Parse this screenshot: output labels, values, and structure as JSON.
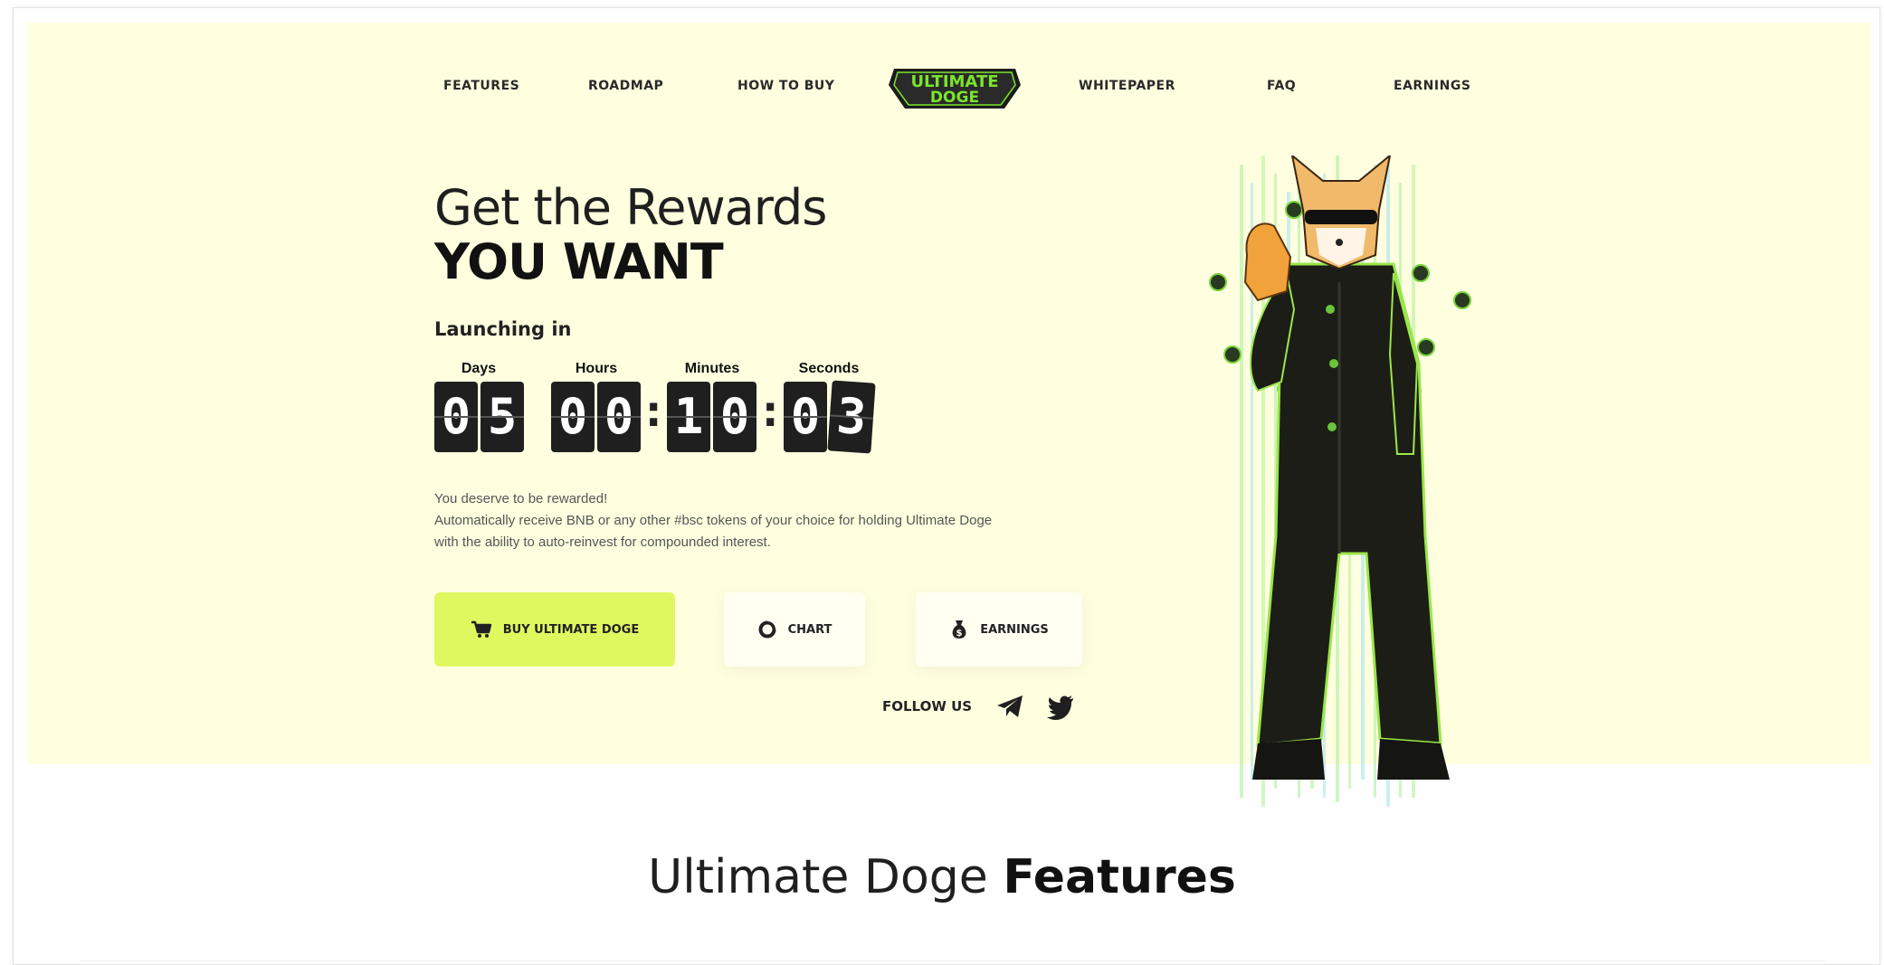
{
  "nav": {
    "items": [
      "FEATURES",
      "ROADMAP",
      "HOW TO BUY",
      "WHITEPAPER",
      "FAQ",
      "EARNINGS"
    ],
    "logo_line1": "ULTIMATE",
    "logo_line2": "DOGE"
  },
  "hero": {
    "title_line1": "Get the Rewards",
    "title_line2": "YOU WANT",
    "launching_label": "Launching in",
    "countdown": {
      "labels": [
        "Days",
        "Hours",
        "Minutes",
        "Seconds"
      ],
      "days": [
        "0",
        "5"
      ],
      "hours": [
        "0",
        "0"
      ],
      "minutes": [
        "1",
        "0"
      ],
      "seconds": [
        "0",
        "3"
      ]
    },
    "description": [
      "You deserve to be rewarded!",
      "Automatically receive BNB or any other #bsc tokens of your choice for holding Ultimate Doge",
      "with the ability to auto-reinvest for compounded interest."
    ],
    "buttons": {
      "buy": "BUY ULTIMATE DOGE",
      "chart": "CHART",
      "earnings": "EARNINGS"
    },
    "follow_label": "FOLLOW US"
  },
  "features_section": {
    "title_regular": "Ultimate Doge ",
    "title_bold": "Features"
  },
  "colors": {
    "hero_bg": "#ffffe0",
    "accent": "#e0f85f",
    "logo_green": "#7be52b",
    "dark": "#1f1f1f"
  },
  "icons": {
    "buy": "cart-icon",
    "chart": "chart-ring-icon",
    "earnings": "money-bag-icon",
    "telegram": "telegram-icon",
    "twitter": "twitter-icon"
  }
}
